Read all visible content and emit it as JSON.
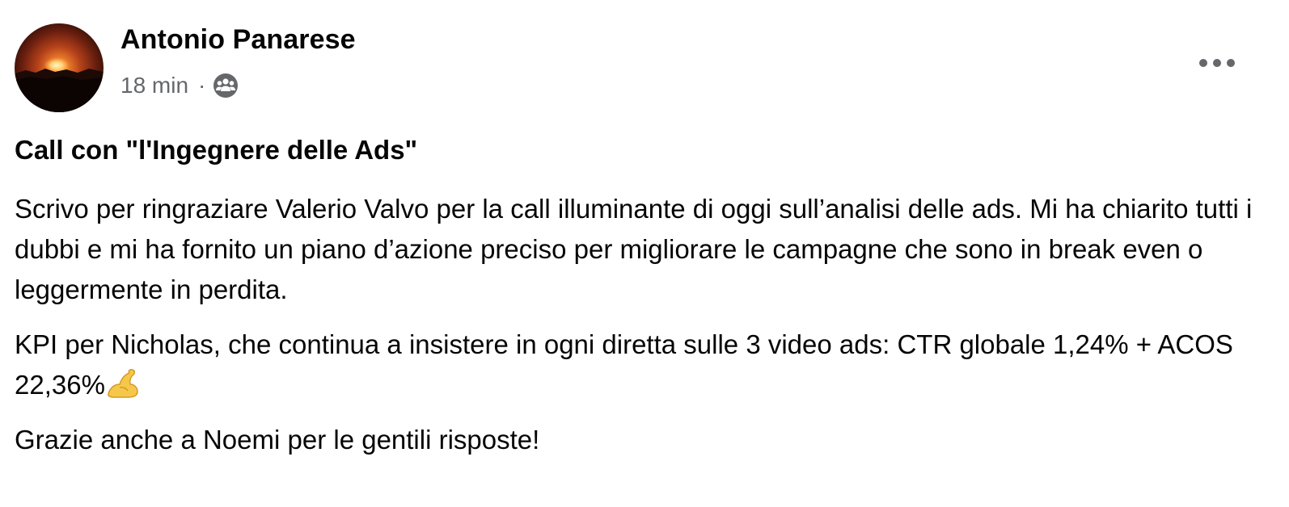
{
  "post": {
    "author": "Antonio Panarese",
    "timestamp": "18 min",
    "separator": "·",
    "audience_icon": "group-icon",
    "more_icon": "more-options-icon",
    "title": "Call con \"l'Ingegnere delle Ads\"",
    "paragraphs": [
      "Scrivo per ringraziare Valerio Valvo per la call illuminante di oggi sull’analisi delle ads. Mi ha chiarito tutti i dubbi e mi ha fornito un piano d’azione preciso per migliorare le campagne che sono in break even o leggermente in perdita.",
      "KPI per Nicholas, che continua a insistere in ogni diretta sulle 3 video ads: CTR globale 1,24% + ACOS 22,36%",
      "Grazie anche a Noemi per le gentili risposte!"
    ],
    "emoji": "flexed-biceps-emoji"
  },
  "colors": {
    "text_primary": "#050505",
    "text_secondary": "#65676b",
    "icon": "#65676b",
    "background": "#ffffff"
  }
}
